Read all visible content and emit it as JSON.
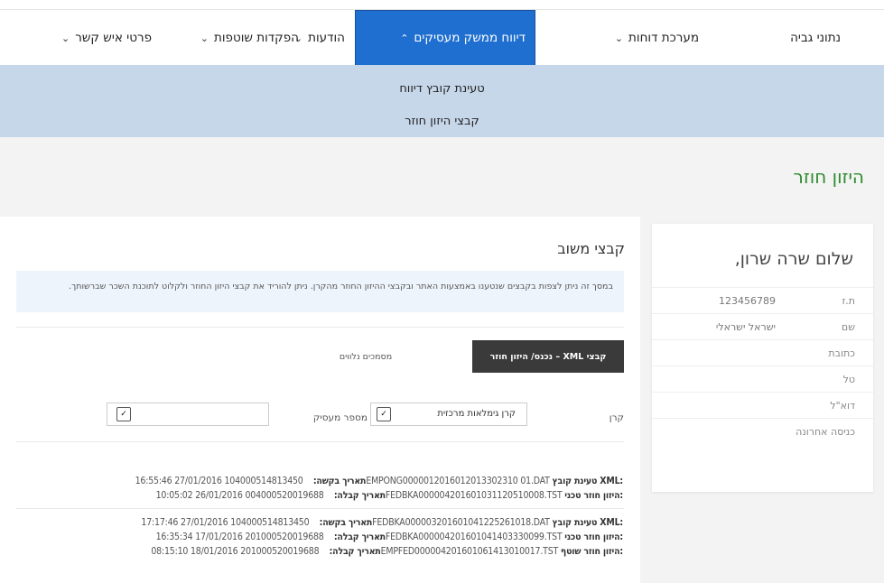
{
  "nav": {
    "items": [
      {
        "label": "נתוני גביה",
        "chevron": false
      },
      {
        "label": "מערכת דוחות",
        "chevron": true
      },
      {
        "label": "דיווח ממשק מעסיקים",
        "chevron": true,
        "active": true
      },
      {
        "label": "הודעות",
        "chevron": true
      },
      {
        "label": "הפקדות שוטפות",
        "chevron": true
      },
      {
        "label": "פרטי איש קשר",
        "chevron": true
      }
    ]
  },
  "submenu": {
    "items": [
      "טעינת קובץ דיווח",
      "קבצי היזון חוזר"
    ]
  },
  "banner": {
    "title": "היזון חוזר"
  },
  "user_card": {
    "greeting": "שלום שרה שרון,",
    "fields": [
      {
        "label": "ת.ז",
        "value": "123456789"
      },
      {
        "label": "שם",
        "value": "ישראל ישראלי"
      },
      {
        "label": "כתובת",
        "value": ""
      },
      {
        "label": "טל",
        "value": ""
      },
      {
        "label": "דוא\"ל",
        "value": ""
      },
      {
        "label": "כניסה אחרונה",
        "value": ""
      }
    ]
  },
  "main": {
    "section_title": "קבצי משוב",
    "info_text": "במסך זה ניתן לצפות בקבצים שנטענו באמצעות האתר ובקבצי ההיזון החוזר מהקרן. ניתן להוריד את קבצי היזון החוזר ולקלוט לתוכנת השכר שברשותך.",
    "tabs": [
      {
        "label": "קבצי XML – נכנס/ היזון חוזר",
        "active": true
      },
      {
        "label": "מסמכים נלווים",
        "active": false
      }
    ],
    "filters": {
      "fund_label": "קרן",
      "fund_value": "קרן גימלאות מרכזית",
      "employer_label": "מספר מעסיק",
      "employer_value": ""
    },
    "arrow_glyph": "✓",
    "records": [
      [
        {
          "prefix": "טעינת קובץ XML:",
          "file": "104000514813450EMPONG0000012016012013302310 01.DAT",
          "date_label": "תאריך בקשה:",
          "date": "16:55:46 27/01/2016"
        },
        {
          "prefix": "היזון חוזר טכני:",
          "file": "004000520019688FEDBKA000004201601031120510008.TST",
          "date_label": "תאריך קבלה:",
          "date": "10:05:02 26/01/2016"
        }
      ],
      [
        {
          "prefix": "טעינת קובץ XML:",
          "file": "104000514813450FEDBKA000003201601041225261018.DAT",
          "date_label": "תאריך בקשה:",
          "date": "17:17:46 27/01/2016"
        },
        {
          "prefix": "היזון חוזר טכני:",
          "file": "201000520019688FEDBKA000004201601041403330099.TST",
          "date_label": "תאריך קבלה:",
          "date": "16:35:34 17/01/2016"
        },
        {
          "prefix": "היזון חוזר שוטף:",
          "file": "201000520019688EMPFED000004201601061413010017.TST",
          "date_label": "תאריך קבלה:",
          "date": "08:15:10 18/01/2016"
        }
      ]
    ]
  }
}
